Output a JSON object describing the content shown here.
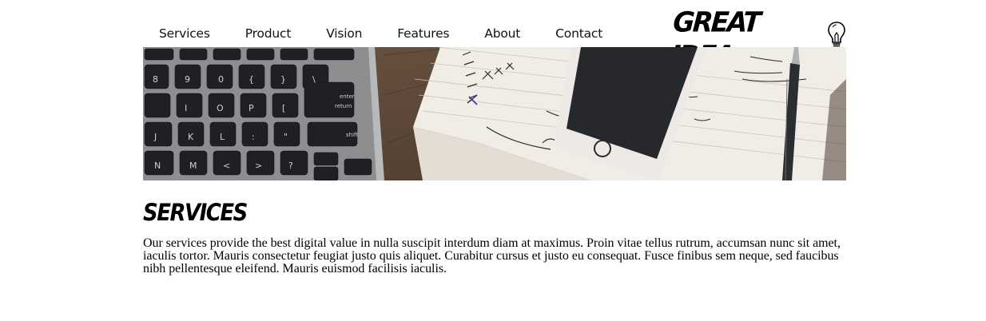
{
  "nav": {
    "items": [
      {
        "label": "Services"
      },
      {
        "label": "Product"
      },
      {
        "label": "Vision"
      },
      {
        "label": "Features"
      },
      {
        "label": "About"
      },
      {
        "label": "Contact"
      }
    ]
  },
  "logo": {
    "text": "GREAT IDEA",
    "icon": "lightbulb-icon"
  },
  "hero": {
    "image": "laptop-keyboard-phone-notebook-photo"
  },
  "section": {
    "title": "SERVICES",
    "body": "Our services provide the best digital value in nulla suscipit interdum diam at maximus. Proin vitae tellus rutrum, accumsan nunc sit amet, iaculis tortor. Mauris consectetur feugiat justo quis aliquet. Curabitur cursus et justo eu consequat. Fusce finibus sem neque, sed faucibus nibh pellentesque eleifend. Mauris euismod facilisis iaculis."
  }
}
